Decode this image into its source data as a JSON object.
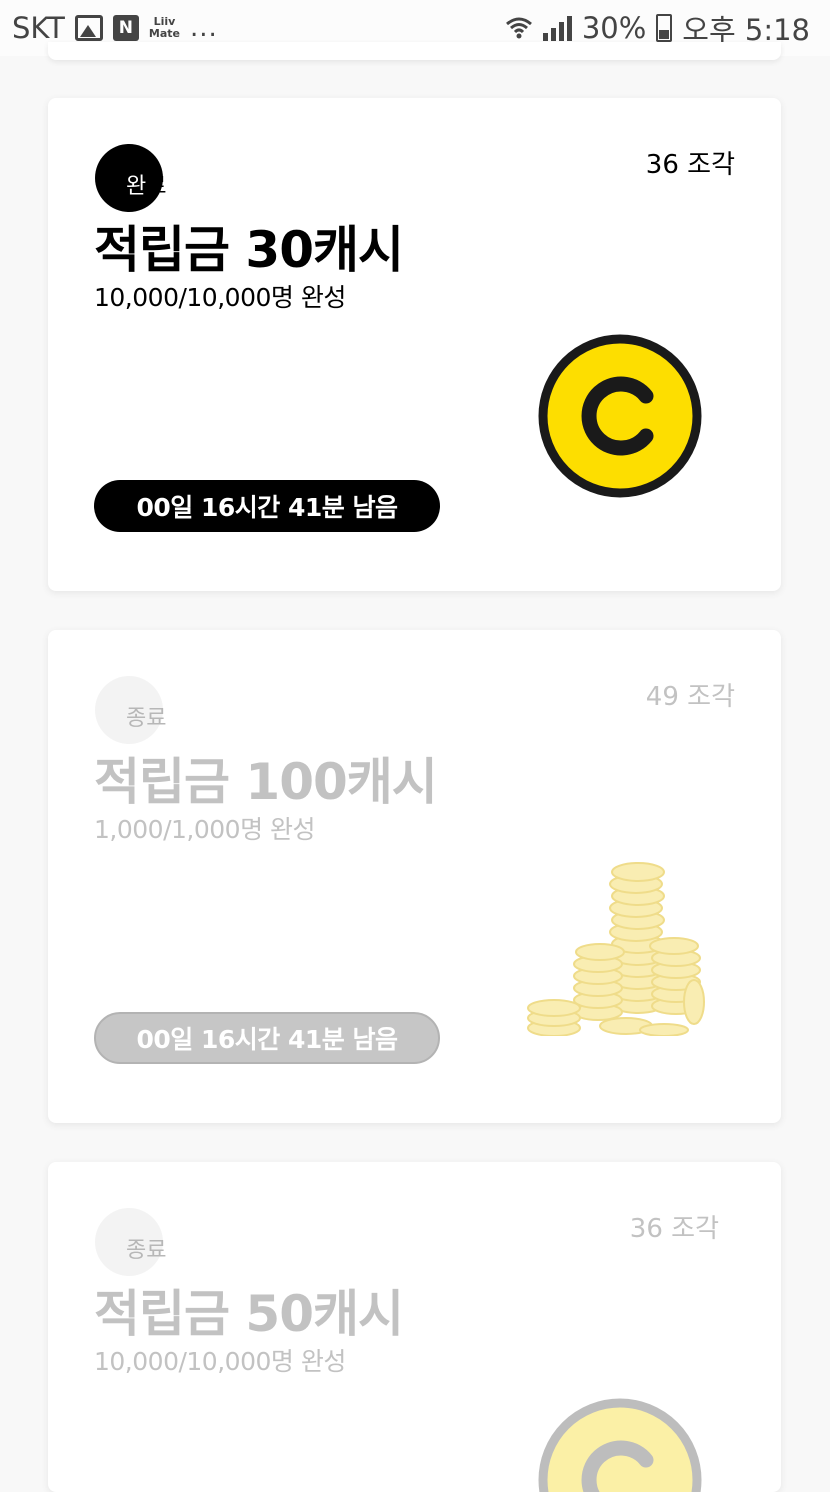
{
  "status_bar": {
    "carrier": "SKT",
    "liiv_line1": "Liiv",
    "liiv_line2": "Mate",
    "n_label": "N",
    "more": "...",
    "battery_percent": "30%",
    "time": "오후 5:18"
  },
  "cards": [
    {
      "badge": "완료",
      "badge_first": "완",
      "badge_rest": "료",
      "pieces": "36 조각",
      "title": "적립금 30캐시",
      "progress": "10,000/10,000명 완성",
      "timer": "00일 16시간 41분 남음",
      "image": "cash-coin-icon",
      "state": "done"
    },
    {
      "badge": "종료",
      "badge_first": "종",
      "badge_rest": "료",
      "pieces": "49 조각",
      "title": "적립금 100캐시",
      "progress": "1,000/1,000명 완성",
      "timer": "00일 16시간 41분 남음",
      "image": "gold-coins-stack",
      "state": "ended"
    },
    {
      "badge": "종료",
      "badge_first": "종",
      "badge_rest": "료",
      "pieces": "36 조각",
      "title": "적립금 50캐시",
      "progress": "10,000/10,000명 완성",
      "image": "cash-coin-icon",
      "state": "ended"
    }
  ],
  "colors": {
    "coin_yellow": "#fdde00",
    "coin_outline": "#1a1a1a",
    "ended_gray": "#c2c2c2"
  }
}
